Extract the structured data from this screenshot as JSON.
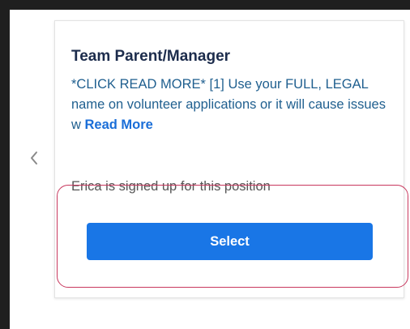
{
  "nav": {
    "prev_icon": "chevron-left-icon"
  },
  "card": {
    "title": "Team Parent/Manager",
    "description": "*CLICK READ MORE* [1] Use your FULL, LEGAL name on volunteer applications or it will cause issues w",
    "read_more_label": "Read More",
    "signup_status": "Erica is signed up for this position",
    "select_label": "Select"
  },
  "colors": {
    "title": "#1c2c4c",
    "description": "#1f5f8f",
    "link": "#1a6ed8",
    "button": "#1976e6",
    "highlight": "#c8385e"
  }
}
